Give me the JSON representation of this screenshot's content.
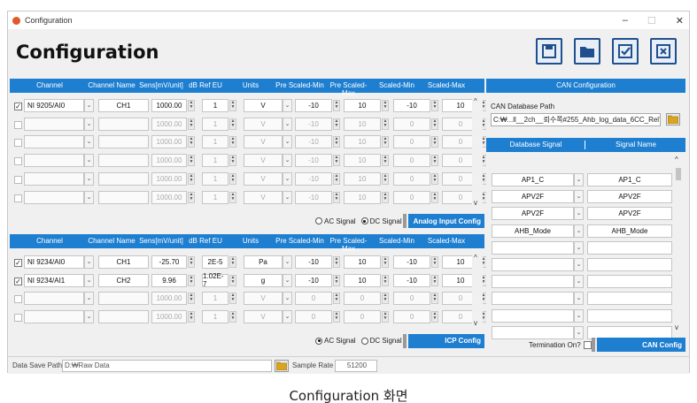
{
  "window": {
    "title": "Configuration",
    "controls": {
      "minimize": "–",
      "maximize": "☐",
      "close": "✕"
    }
  },
  "header": {
    "title": "Configuration"
  },
  "toolbar": {
    "save": "save-icon",
    "open": "folder-icon",
    "apply": "check-icon",
    "cancel": "close-icon"
  },
  "columns": [
    "Channel",
    "Channel Name",
    "Sens[mV/unit]",
    "dB Ref EU",
    "Units",
    "Pre Scaled-Min",
    "Pre Scaled-Max",
    "Scaled-Min",
    "Scaled-Max"
  ],
  "analog": {
    "rows": [
      {
        "checked": true,
        "enabled": true,
        "channel": "NI 9205/AI0",
        "name": "CH1",
        "sens": "1000.00",
        "dbref": "1",
        "units": "V",
        "pmin": "-10",
        "pmax": "10",
        "smin": "-10",
        "smax": "10"
      },
      {
        "checked": false,
        "enabled": false,
        "channel": "",
        "name": "",
        "sens": "1000.00",
        "dbref": "1",
        "units": "V",
        "pmin": "-10",
        "pmax": "10",
        "smin": "0",
        "smax": "0"
      },
      {
        "checked": false,
        "enabled": false,
        "channel": "",
        "name": "",
        "sens": "1000.00",
        "dbref": "1",
        "units": "V",
        "pmin": "-10",
        "pmax": "10",
        "smin": "0",
        "smax": "0"
      },
      {
        "checked": false,
        "enabled": false,
        "channel": "",
        "name": "",
        "sens": "1000.00",
        "dbref": "1",
        "units": "V",
        "pmin": "-10",
        "pmax": "10",
        "smin": "0",
        "smax": "0"
      },
      {
        "checked": false,
        "enabled": false,
        "channel": "",
        "name": "",
        "sens": "1000.00",
        "dbref": "1",
        "units": "V",
        "pmin": "-10",
        "pmax": "10",
        "smin": "0",
        "smax": "0"
      },
      {
        "checked": false,
        "enabled": false,
        "channel": "",
        "name": "",
        "sens": "1000.00",
        "dbref": "1",
        "units": "V",
        "pmin": "-10",
        "pmax": "10",
        "smin": "0",
        "smax": "0"
      }
    ],
    "ac_label": "AC Signal",
    "dc_label": "DC Signal",
    "ac_selected": false,
    "config_button": "Analog Input Config"
  },
  "icp": {
    "rows": [
      {
        "checked": true,
        "enabled": true,
        "channel": "NI 9234/AI0",
        "name": "CH1",
        "sens": "-25.70",
        "dbref": "2E-5",
        "units": "Pa",
        "pmin": "-10",
        "pmax": "10",
        "smin": "-10",
        "smax": "10"
      },
      {
        "checked": true,
        "enabled": true,
        "channel": "NI 9234/AI1",
        "name": "CH2",
        "sens": "9.96",
        "dbref": "1.02E-7",
        "units": "g",
        "pmin": "-10",
        "pmax": "10",
        "smin": "-10",
        "smax": "10"
      },
      {
        "checked": false,
        "enabled": false,
        "channel": "",
        "name": "",
        "sens": "1000.00",
        "dbref": "1",
        "units": "V",
        "pmin": "0",
        "pmax": "0",
        "smin": "0",
        "smax": "0"
      },
      {
        "checked": false,
        "enabled": false,
        "channel": "",
        "name": "",
        "sens": "1000.00",
        "dbref": "1",
        "units": "V",
        "pmin": "0",
        "pmax": "0",
        "smin": "0",
        "smax": "0"
      }
    ],
    "ac_label": "AC Signal",
    "dc_label": "DC Signal",
    "ac_selected": true,
    "config_button": "ICP Config"
  },
  "can": {
    "title": "CAN Configuration",
    "db_path_label": "CAN Database Path",
    "db_path": "C:₩...ll__2ch__뢰수쪽#255_Ahb_log_data_6CC_RelTest.dbc",
    "col_signal": "Database Signal",
    "col_name": "Signal Name",
    "rows": [
      {
        "signal": "AP1_C",
        "name": "AP1_C"
      },
      {
        "signal": "APV2F",
        "name": "APV2F"
      },
      {
        "signal": "APV2F",
        "name": "APV2F"
      },
      {
        "signal": "AHB_Mode",
        "name": "AHB_Mode"
      },
      {
        "signal": "",
        "name": ""
      },
      {
        "signal": "",
        "name": ""
      },
      {
        "signal": "",
        "name": ""
      },
      {
        "signal": "",
        "name": ""
      },
      {
        "signal": "",
        "name": ""
      },
      {
        "signal": "",
        "name": ""
      }
    ],
    "termination_label": "Termination On?",
    "config_button": "CAN Config"
  },
  "status": {
    "save_path_label": "Data Save Path :",
    "save_path": "D:₩Raw Data",
    "sample_rate_label": "Sample Rate :",
    "sample_rate": "51200"
  },
  "caption": "Configuration 화면"
}
